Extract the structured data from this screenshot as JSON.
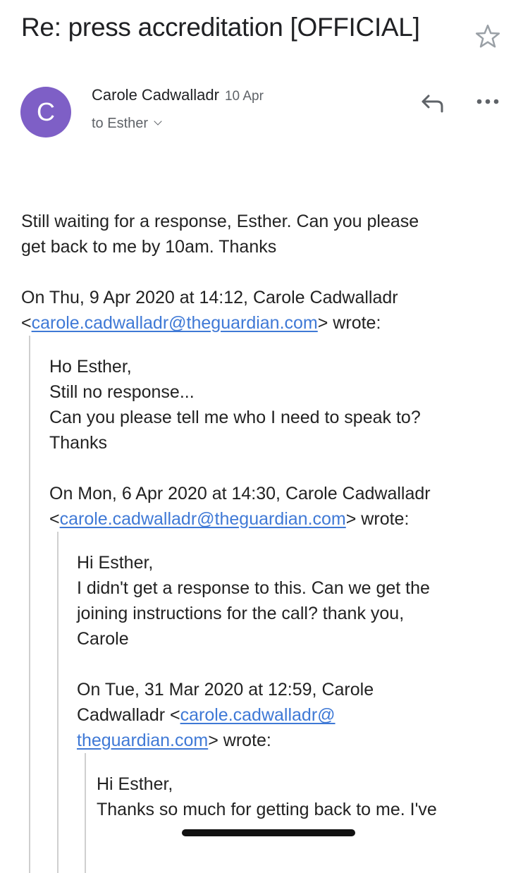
{
  "email": {
    "subject": "Re: press accreditation [OFFICIAL]",
    "icons": {
      "star": "star-outline-icon",
      "reply": "reply-arrow-icon",
      "more": "more-horizontal-icon",
      "recipient_toggle": "chevron-down-icon"
    },
    "sender": {
      "name": "Carole Cadwalladr",
      "avatar_initial": "C",
      "avatar_color": "#7e5fc6",
      "date": "10 Apr",
      "recipient": "to Esther"
    },
    "body": {
      "lines": [
        "Still waiting for a response, Esther. Can you please",
        "get back to me by 10am. Thanks"
      ],
      "quote1": {
        "header_line1": "On Thu, 9 Apr 2020 at 14:12, Carole Cadwalladr",
        "header_open": "<",
        "email": "carole.cadwalladr@theguardian.com",
        "header_close": "> wrote:",
        "lines": [
          "Ho Esther,",
          "Still no response...",
          "Can you please tell me who I need to speak to?",
          "Thanks"
        ],
        "quote2": {
          "header_line1": "On Mon, 6 Apr 2020 at 14:30, Carole Cadwalladr",
          "header_open": "<",
          "email": "carole.cadwalladr@theguardian.com",
          "header_close": "> wrote:",
          "lines": [
            "Hi Esther,",
            "I didn't get a response to this. Can we get the",
            "joining instructions for the call? thank you,",
            "Carole"
          ],
          "quote3": {
            "header_line1": "On Tue, 31 Mar 2020 at 12:59, Carole",
            "header_line2_prefix": "Cadwalladr <",
            "email_part1": "carole.cadwalladr@",
            "email_part2": "theguardian.com",
            "header_close": "> wrote:",
            "lines": [
              "Hi Esther,",
              "Thanks so much for getting back to me. I've"
            ]
          }
        }
      }
    },
    "link_color": "#3f79d6"
  }
}
